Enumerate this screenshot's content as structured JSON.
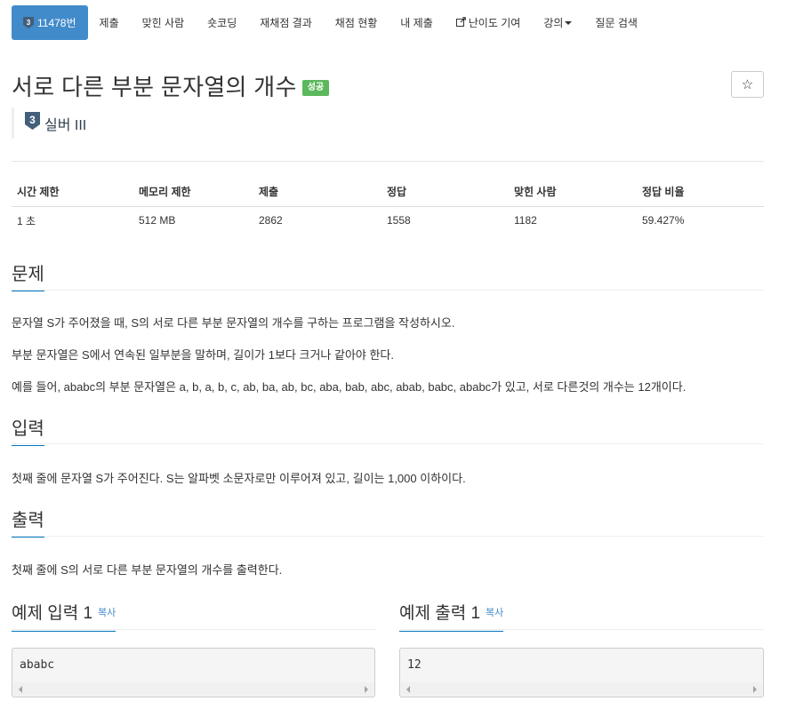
{
  "nav": {
    "problem_id": "11478번",
    "items": [
      {
        "label": "제출"
      },
      {
        "label": "맞힌 사람"
      },
      {
        "label": "숏코딩"
      },
      {
        "label": "재채점 결과"
      },
      {
        "label": "채점 현황"
      },
      {
        "label": "내 제출"
      },
      {
        "label": "난이도 기여",
        "icon": "external-link-icon"
      },
      {
        "label": "강의",
        "icon": "caret-down-icon"
      },
      {
        "label": "질문 검색"
      }
    ]
  },
  "problem": {
    "title": "서로 다른 부분 문자열의 개수",
    "status": "성공",
    "tier_number": "3",
    "tier": "실버 III",
    "tier_color": "#435f7a"
  },
  "info": {
    "headers": [
      "시간 제한",
      "메모리 제한",
      "제출",
      "정답",
      "맞힌 사람",
      "정답 비율"
    ],
    "values": [
      "1 초",
      "512 MB",
      "2862",
      "1558",
      "1182",
      "59.427%"
    ]
  },
  "sections": {
    "description": {
      "title": "문제",
      "paragraphs": [
        "문자열 S가 주어졌을 때, S의 서로 다른 부분 문자열의 개수를 구하는 프로그램을 작성하시오.",
        "부분 문자열은 S에서 연속된 일부분을 말하며, 길이가 1보다 크거나 같아야 한다.",
        "예를 들어, ababc의 부분 문자열은 a, b, a, b, c, ab, ba, ab, bc, aba, bab, abc, abab, babc, ababc가 있고, 서로 다른것의 개수는 12개이다."
      ]
    },
    "input": {
      "title": "입력",
      "text": "첫째 줄에 문자열 S가 주어진다. S는 알파벳 소문자로만 이루어져 있고, 길이는 1,000 이하이다."
    },
    "output": {
      "title": "출력",
      "text": "첫째 줄에 S의 서로 다른 부분 문자열의 개수를 출력한다."
    }
  },
  "samples": {
    "copy_label": "복사",
    "input": {
      "title": "예제 입력 1",
      "value": "ababc"
    },
    "output": {
      "title": "예제 출력 1",
      "value": "12"
    }
  },
  "colors": {
    "nav_active": "#428bca",
    "success": "#5cb85c",
    "section_underline": "#0076c0"
  }
}
